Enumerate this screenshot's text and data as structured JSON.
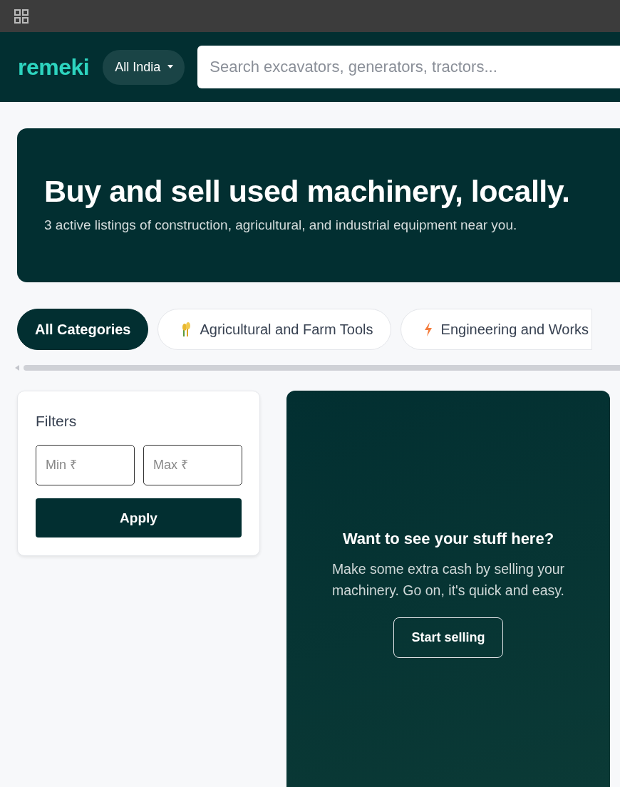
{
  "header": {
    "logo": "remeki",
    "location": "All India",
    "search": {
      "placeholder": "Search excavators, generators, tractors..."
    }
  },
  "hero": {
    "title": "Buy and sell used machinery, locally.",
    "subtitle": "3 active listings of construction, agricultural, and industrial equipment near you."
  },
  "categories": [
    {
      "label": "All Categories",
      "kind": "plain",
      "selected": true
    },
    {
      "label": "Agricultural and Farm Tools",
      "kind": "wheat",
      "selected": false
    },
    {
      "label": "Engineering and Works",
      "kind": "bolt",
      "selected": false
    }
  ],
  "filters": {
    "title": "Filters",
    "min": {
      "placeholder": "Min ₹"
    },
    "max": {
      "placeholder": "Max ₹"
    },
    "apply": "Apply"
  },
  "promo": {
    "title": "Want to see your stuff here?",
    "text": "Make some extra cash by selling your machinery. Go on, it's quick and easy.",
    "button": "Start selling"
  }
}
